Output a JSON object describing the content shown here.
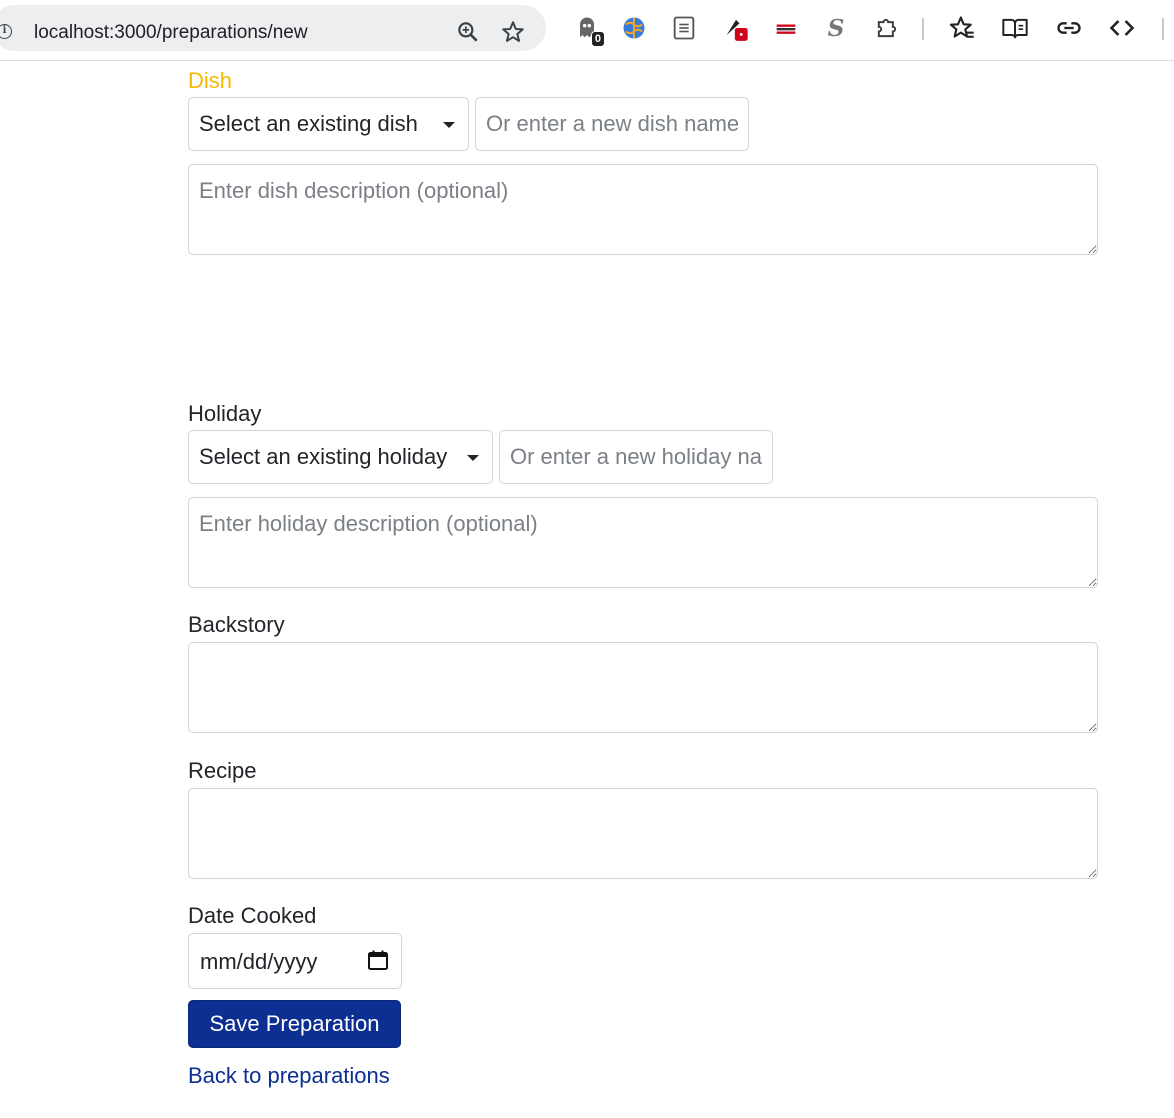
{
  "browser": {
    "url": "localhost:3000/preparations/new",
    "extension_badge": "0"
  },
  "form": {
    "dish": {
      "label": "Dish",
      "select_value": "Select an existing dish",
      "new_placeholder": "Or enter a new dish name",
      "description_placeholder": "Enter dish description (optional)"
    },
    "holiday": {
      "label": "Holiday",
      "select_value": "Select an existing holiday",
      "new_placeholder": "Or enter a new holiday name",
      "description_placeholder": "Enter holiday description (optional)"
    },
    "backstory": {
      "label": "Backstory"
    },
    "recipe": {
      "label": "Recipe"
    },
    "date_cooked": {
      "label": "Date Cooked",
      "placeholder": "mm/dd/yyyy"
    },
    "save_label": "Save Preparation",
    "back_label": "Back to preparations"
  },
  "colors": {
    "dish_label": "#f5b800",
    "primary": "#0d2f91"
  },
  "icons": {
    "omnibox": [
      "info-icon",
      "zoom-icon",
      "bookmark-star-icon"
    ],
    "extensions": [
      "ghostery-icon",
      "globe-icon",
      "reader-doc-icon",
      "pen-tool-icon",
      "flag-icon",
      "s-icon",
      "puzzle-icon",
      "star-list-icon",
      "reading-list-icon",
      "link-icon",
      "code-icon"
    ]
  }
}
